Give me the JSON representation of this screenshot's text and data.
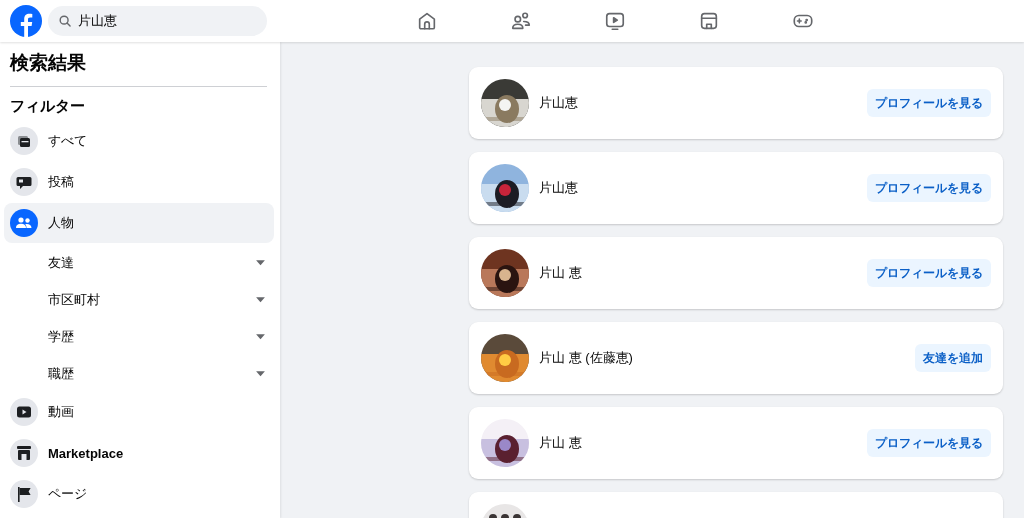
{
  "header": {
    "search": {
      "value": "片山恵"
    },
    "nav": [
      {
        "selected": false
      },
      {
        "selected": false
      },
      {
        "selected": false
      },
      {
        "selected": false
      },
      {
        "selected": false
      }
    ]
  },
  "sidebar": {
    "title": "検索結果",
    "filter_title": "フィルター",
    "items": [
      {
        "kind": "category",
        "label": "すべて",
        "selected": false
      },
      {
        "kind": "category",
        "label": "投稿",
        "selected": false
      },
      {
        "kind": "category",
        "label": "人物",
        "selected": true
      },
      {
        "kind": "subfilter",
        "label": "友達"
      },
      {
        "kind": "subfilter",
        "label": "市区町村"
      },
      {
        "kind": "subfilter",
        "label": "学歴"
      },
      {
        "kind": "subfilter",
        "label": "職歴"
      },
      {
        "kind": "category",
        "label": "動画",
        "selected": false
      },
      {
        "kind": "category",
        "label": "Marketplace",
        "selected": false
      },
      {
        "kind": "category",
        "label": "ページ",
        "selected": false
      }
    ]
  },
  "results": [
    {
      "name": "片山恵",
      "button": "プロフィールを見る"
    },
    {
      "name": "片山恵",
      "button": "プロフィールを見る"
    },
    {
      "name": "片山 恵",
      "button": "プロフィールを見る"
    },
    {
      "name": "片山 恵 (佐藤恵)",
      "button": "友達を追加"
    },
    {
      "name": "片山 恵",
      "button": "プロフィールを見る"
    }
  ]
}
